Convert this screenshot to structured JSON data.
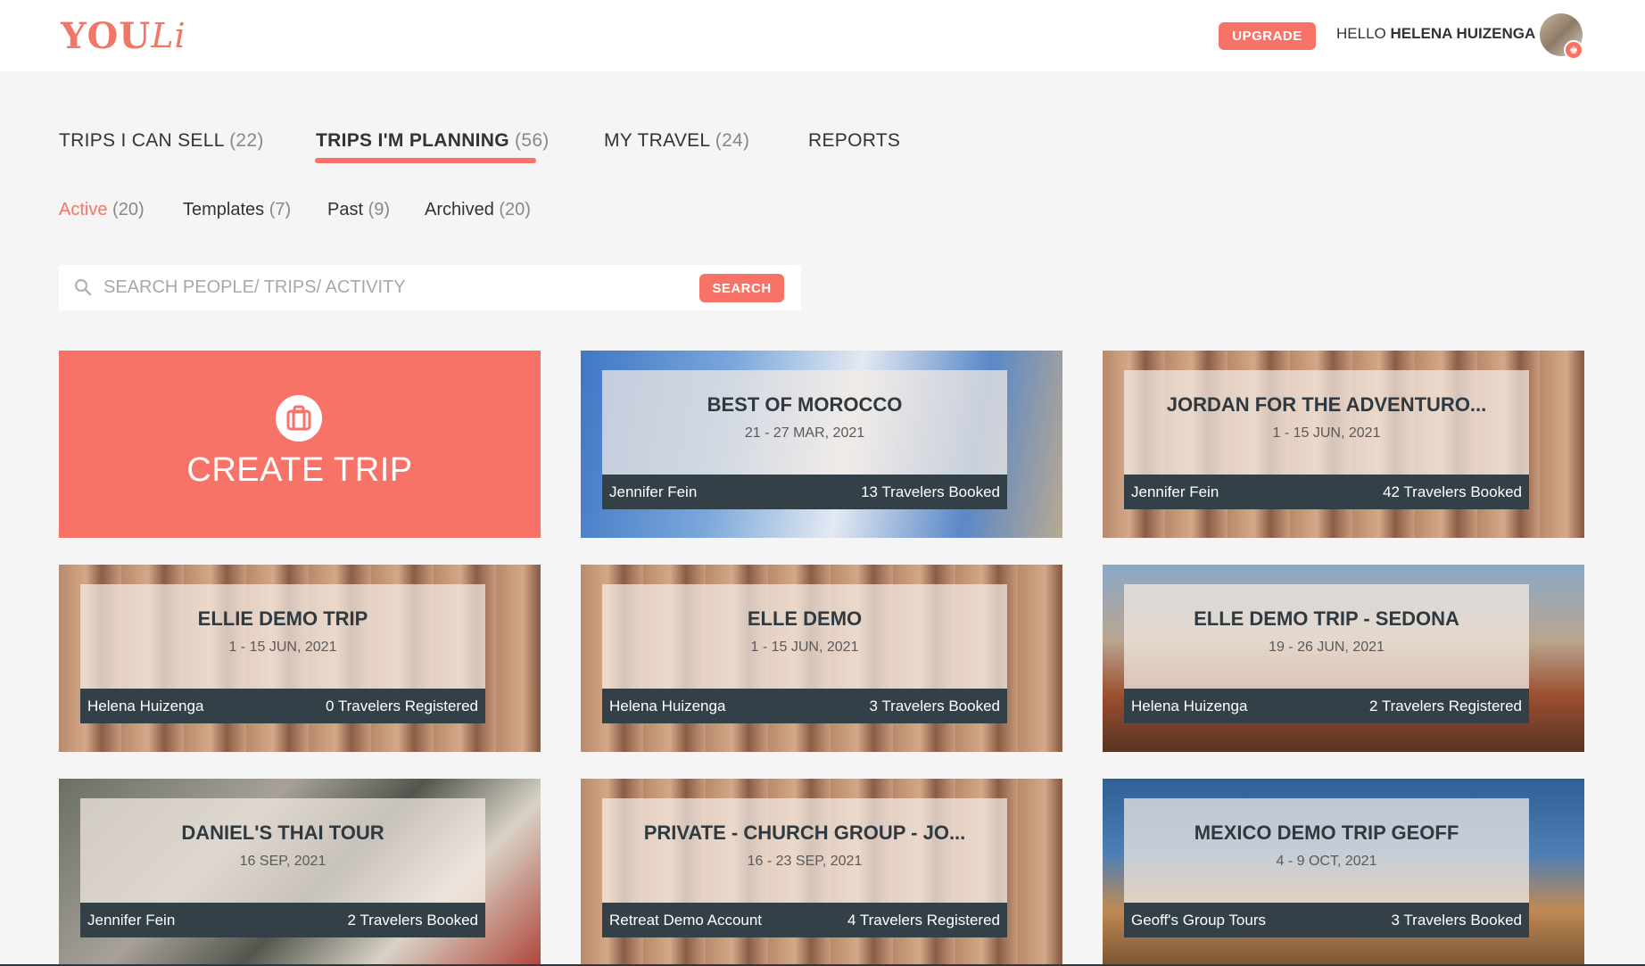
{
  "header": {
    "logo_text_main": "YOU",
    "logo_text_script": "Li",
    "upgrade_label": "UPGRADE",
    "greeting": "HELLO",
    "user_name": "HELENA HUIZENGA"
  },
  "tabs": [
    {
      "label": "TRIPS I CAN SELL",
      "count": "(22)"
    },
    {
      "label": "TRIPS I'M PLANNING",
      "count": "(56)"
    },
    {
      "label": "MY TRAVEL",
      "count": "(24)"
    },
    {
      "label": "REPORTS",
      "count": ""
    }
  ],
  "subtabs": [
    {
      "label": "Active",
      "count": "(20)"
    },
    {
      "label": "Templates",
      "count": "(7)"
    },
    {
      "label": "Past",
      "count": "(9)"
    },
    {
      "label": "Archived",
      "count": "(20)"
    }
  ],
  "search": {
    "placeholder": "SEARCH PEOPLE/ TRIPS/ ACTIVITY",
    "button_label": "SEARCH"
  },
  "create_trip": {
    "label": "CREATE TRIP"
  },
  "trips": [
    {
      "title": "BEST OF MOROCCO",
      "dates": "21 - 27 MAR, 2021",
      "owner": "Jennifer Fein",
      "booked": "13 Travelers Booked"
    },
    {
      "title": "JORDAN FOR THE ADVENTURO...",
      "dates": "1 - 15 JUN, 2021",
      "owner": "Jennifer Fein",
      "booked": "42 Travelers Booked"
    },
    {
      "title": "ELLIE DEMO TRIP",
      "dates": "1 - 15 JUN, 2021",
      "owner": "Helena Huizenga",
      "booked": "0 Travelers Registered"
    },
    {
      "title": "ELLE DEMO",
      "dates": "1 - 15 JUN, 2021",
      "owner": "Helena Huizenga",
      "booked": "3 Travelers Booked"
    },
    {
      "title": "ELLE DEMO TRIP - SEDONA",
      "dates": "19 - 26 JUN, 2021",
      "owner": "Helena Huizenga",
      "booked": "2 Travelers Registered"
    },
    {
      "title": "DANIEL'S THAI TOUR",
      "dates": "16 SEP, 2021",
      "owner": "Jennifer Fein",
      "booked": "2 Travelers Booked"
    },
    {
      "title": "PRIVATE - CHURCH GROUP - JO...",
      "dates": "16 - 23 SEP, 2021",
      "owner": "Retreat Demo Account",
      "booked": "4 Travelers Registered"
    },
    {
      "title": "MEXICO DEMO TRIP GEOFF",
      "dates": "4 - 9 OCT, 2021",
      "owner": "Geoff's Group Tours",
      "booked": "3 Travelers Booked"
    }
  ],
  "colors": {
    "accent": "#f77367",
    "card_bar": "#344047",
    "page_bg": "#f4f5f4"
  }
}
